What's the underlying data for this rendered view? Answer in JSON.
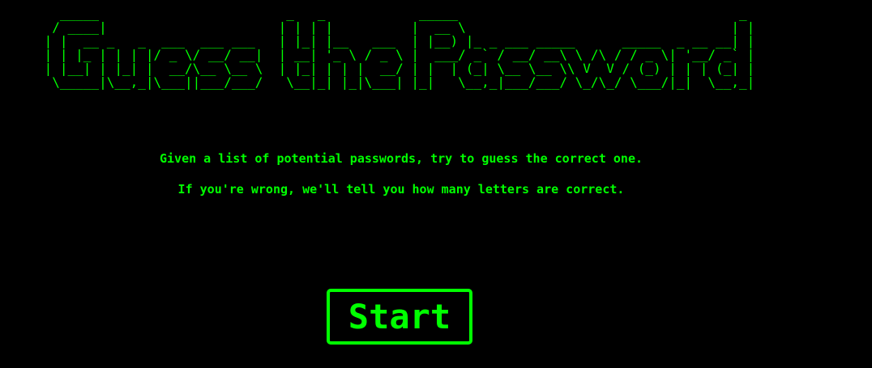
{
  "title": {
    "text": "Guess the Password",
    "ascii_art": "   _____                        _   _            _____                                    _ \n  / ____|                      | | | |          |  __ \\                                  | |\n | |  __ _   _  ___  ___ ___   | |_| |__   ___  | |__) |_ _ ___ _____      _____  _ __ __| |\n | | |_ | | | |/ _ \\/ __/ __|  | __| '_ \\ / _ \\ |  ___/ _` / __/ __\\ \\ /\\ / / _ \\| '__/ _` |\n | |__| | |_| |  __/\\__ \\__ \\  | |_| | | |  __/ | |  | (_| \\__ \\__ \\\\ V  V / (_) | | | (_| |\n  \\_____|\\__,_|\\___||___/___/   \\__|_| |_|\\___| |_|   \\__,_|___/___/ \\_/\\_/ \\___/|_|  \\__,_|"
  },
  "instructions": {
    "line1": "Given a list of potential passwords, try to guess the correct one.",
    "line2": "If you're wrong, we'll tell you how many letters are correct."
  },
  "start_button": {
    "label": "Start"
  },
  "colors": {
    "background": "#000000",
    "foreground": "#00ff00"
  }
}
